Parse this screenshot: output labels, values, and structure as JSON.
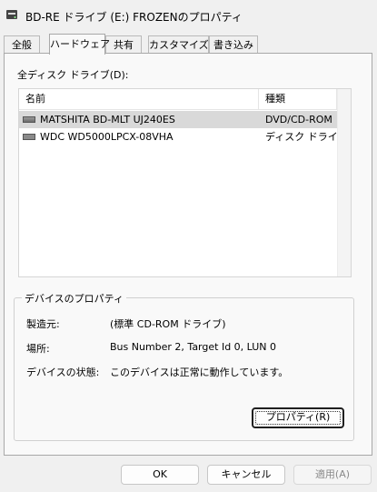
{
  "window": {
    "title": "BD-RE ドライブ (E:) FROZENのプロパティ",
    "icon": "drive-icon"
  },
  "tabs": [
    {
      "label": "全般",
      "active": false
    },
    {
      "label": "ハードウェア",
      "active": true
    },
    {
      "label": "共有",
      "active": false
    },
    {
      "label": "カスタマイズ",
      "active": false
    },
    {
      "label": "書き込み",
      "active": false
    }
  ],
  "drives": {
    "label": "全ディスク ドライブ(D):",
    "columns": {
      "name": "名前",
      "type": "種類"
    },
    "rows": [
      {
        "name": "MATSHITA BD-MLT UJ240ES",
        "type": "DVD/CD-ROM ドライブ",
        "selected": true
      },
      {
        "name": "WDC WD5000LPCX-08VHA",
        "type": "ディスク ドライブ",
        "selected": false
      }
    ]
  },
  "device_properties": {
    "title": "デバイスのプロパティ",
    "manufacturer_label": "製造元:",
    "manufacturer_value": "(標準 CD-ROM ドライブ)",
    "location_label": "場所:",
    "location_value": "Bus Number 2, Target Id 0, LUN 0",
    "status_label": "デバイスの状態:",
    "status_value": "このデバイスは正常に動作しています。",
    "properties_button": "プロパティ(R)"
  },
  "footer": {
    "ok": "OK",
    "cancel": "キャンセル",
    "apply": "適用(A)"
  },
  "colors": {
    "window_bg": "#f0f0f0",
    "panel_bg": "#f9f9f9",
    "selected_row": "#d9d9d9"
  }
}
